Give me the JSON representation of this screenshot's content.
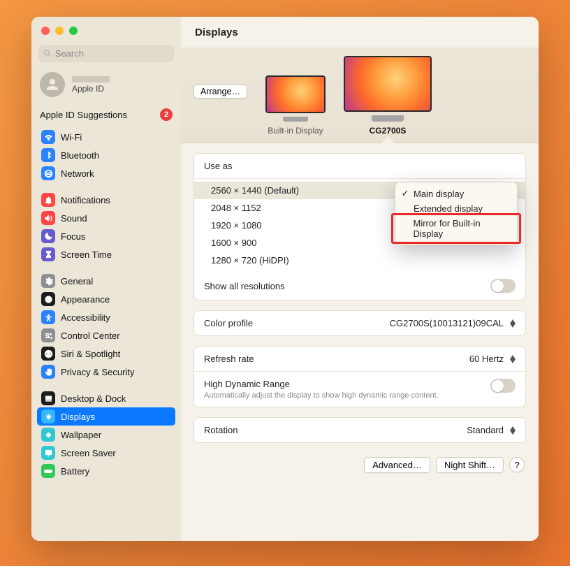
{
  "window": {
    "title": "Displays"
  },
  "search": {
    "placeholder": "Search"
  },
  "apple_id": {
    "label": "Apple ID"
  },
  "suggestions": {
    "label": "Apple ID Suggestions",
    "count": "2"
  },
  "sidebar_groups": [
    [
      {
        "label": "Wi-Fi",
        "bg": "#2b82ff",
        "icon": "wifi"
      },
      {
        "label": "Bluetooth",
        "bg": "#2b82ff",
        "icon": "bluetooth"
      },
      {
        "label": "Network",
        "bg": "#2b82ff",
        "icon": "network"
      }
    ],
    [
      {
        "label": "Notifications",
        "bg": "#ff4645",
        "icon": "bell"
      },
      {
        "label": "Sound",
        "bg": "#ff4645",
        "icon": "sound"
      },
      {
        "label": "Focus",
        "bg": "#6859cf",
        "icon": "moon"
      },
      {
        "label": "Screen Time",
        "bg": "#6859cf",
        "icon": "hourglass"
      }
    ],
    [
      {
        "label": "General",
        "bg": "#8e8e93",
        "icon": "gear"
      },
      {
        "label": "Appearance",
        "bg": "#1c1c1c",
        "icon": "appearance"
      },
      {
        "label": "Accessibility",
        "bg": "#2b82ff",
        "icon": "accessibility"
      },
      {
        "label": "Control Center",
        "bg": "#8e8e93",
        "icon": "sliders"
      },
      {
        "label": "Siri & Spotlight",
        "bg": "#1c1c1c",
        "icon": "siri"
      },
      {
        "label": "Privacy & Security",
        "bg": "#2b82ff",
        "icon": "hand"
      }
    ],
    [
      {
        "label": "Desktop & Dock",
        "bg": "#1c1c1c",
        "icon": "dock"
      },
      {
        "label": "Displays",
        "bg": "#33b7ff",
        "icon": "sun",
        "selected": true
      },
      {
        "label": "Wallpaper",
        "bg": "#33c7d4",
        "icon": "flower"
      },
      {
        "label": "Screen Saver",
        "bg": "#33c7d4",
        "icon": "screensaver"
      },
      {
        "label": "Battery",
        "bg": "#32c758",
        "icon": "battery"
      }
    ]
  ],
  "arrange_label": "Arrange…",
  "displays": [
    {
      "label": "Built-in Display",
      "size": "small",
      "selected": false
    },
    {
      "label": "CG2700S",
      "size": "big",
      "selected": true
    }
  ],
  "use_as": {
    "label": "Use as"
  },
  "resolutions": [
    {
      "label": "2560 × 1440 (Default)",
      "selected": true
    },
    {
      "label": "2048 × 1152"
    },
    {
      "label": "1920 × 1080"
    },
    {
      "label": "1600 × 900"
    },
    {
      "label": "1280 × 720 (HiDPI)"
    }
  ],
  "show_all": "Show all resolutions",
  "color_profile": {
    "label": "Color profile",
    "value": "CG2700S(10013121)09CAL"
  },
  "refresh_rate": {
    "label": "Refresh rate",
    "value": "60 Hertz"
  },
  "hdr": {
    "label": "High Dynamic Range",
    "sub": "Automatically adjust the display to show high dynamic range content."
  },
  "rotation": {
    "label": "Rotation",
    "value": "Standard"
  },
  "footer": {
    "advanced": "Advanced…",
    "night_shift": "Night Shift…",
    "help": "?"
  },
  "popover": [
    {
      "label": "Main display",
      "checked": true
    },
    {
      "label": "Extended display"
    },
    {
      "label": "Mirror for Built-in Display"
    }
  ]
}
